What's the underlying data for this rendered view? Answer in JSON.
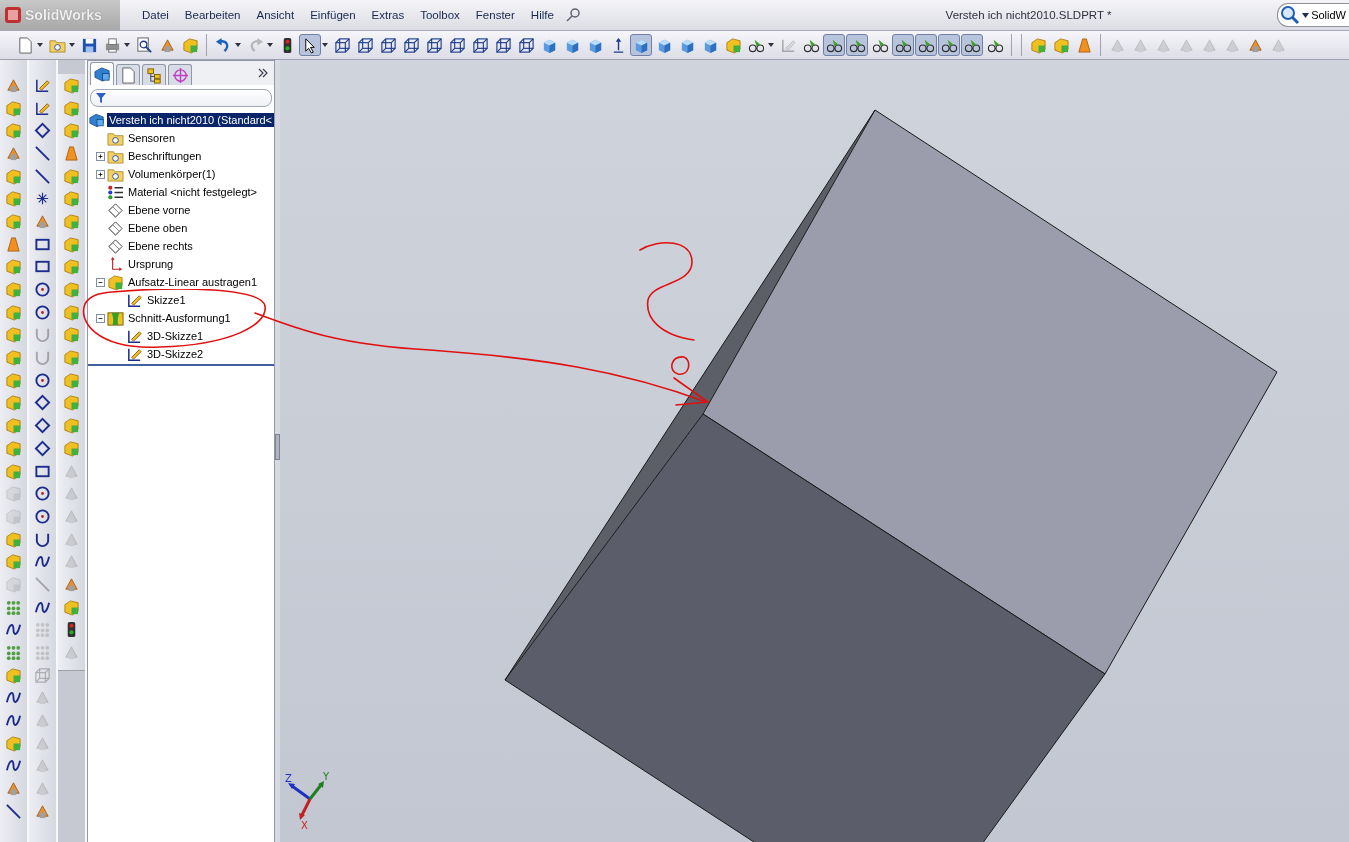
{
  "app": {
    "logo": "SolidWorks"
  },
  "menu": [
    "Datei",
    "Bearbeiten",
    "Ansicht",
    "Einfügen",
    "Extras",
    "Toolbox",
    "Fenster",
    "Hilfe"
  ],
  "window": {
    "title": "Versteh ich nicht2010.SLDPRT *"
  },
  "search": {
    "value": "SolidW"
  },
  "toolbar": [
    {
      "kind": "page",
      "caret": true,
      "selected": false,
      "disabled": false
    },
    {
      "kind": "folder",
      "caret": true,
      "selected": false,
      "disabled": false
    },
    {
      "kind": "floppy",
      "caret": false,
      "selected": false,
      "disabled": false
    },
    {
      "kind": "printer",
      "caret": true,
      "selected": false,
      "disabled": false
    },
    {
      "kind": "magnifier",
      "caret": false,
      "selected": false,
      "disabled": false
    },
    {
      "kind": "tool",
      "caret": false,
      "selected": false,
      "disabled": false
    },
    {
      "kind": "box",
      "caret": false,
      "selected": false,
      "disabled": false
    },
    {
      "kind": "separator"
    },
    {
      "kind": "undo",
      "caret": true,
      "selected": false,
      "disabled": false
    },
    {
      "kind": "redo",
      "caret": true,
      "selected": false,
      "disabled": true
    },
    {
      "kind": "traffic-light",
      "caret": false,
      "selected": false,
      "disabled": false
    },
    {
      "kind": "cursor",
      "caret": true,
      "selected": true,
      "disabled": false
    },
    {
      "kind": "wire-cube",
      "caret": false,
      "selected": false,
      "disabled": false
    },
    {
      "kind": "wire-cube",
      "caret": false,
      "selected": false,
      "disabled": false
    },
    {
      "kind": "wire-cube",
      "caret": false,
      "selected": false,
      "disabled": false
    },
    {
      "kind": "wire-cube",
      "caret": false,
      "selected": false,
      "disabled": false
    },
    {
      "kind": "wire-cube",
      "caret": false,
      "selected": false,
      "disabled": false
    },
    {
      "kind": "wire-cube",
      "caret": false,
      "selected": false,
      "disabled": false
    },
    {
      "kind": "wire-cube",
      "caret": false,
      "selected": false,
      "disabled": false
    },
    {
      "kind": "wire-cube",
      "caret": false,
      "selected": false,
      "disabled": false
    },
    {
      "kind": "wire-cube",
      "caret": false,
      "selected": false,
      "disabled": false
    },
    {
      "kind": "cube",
      "caret": false,
      "selected": false,
      "disabled": false
    },
    {
      "kind": "cube",
      "caret": false,
      "selected": false,
      "disabled": false
    },
    {
      "kind": "cube",
      "caret": false,
      "selected": false,
      "disabled": false
    },
    {
      "kind": "arrow",
      "caret": false,
      "selected": false,
      "disabled": false
    },
    {
      "kind": "cube",
      "caret": false,
      "selected": true,
      "disabled": false
    },
    {
      "kind": "cube",
      "caret": false,
      "selected": false,
      "disabled": false
    },
    {
      "kind": "cube",
      "caret": false,
      "selected": false,
      "disabled": false
    },
    {
      "kind": "cube",
      "caret": false,
      "selected": false,
      "disabled": false
    },
    {
      "kind": "box",
      "caret": false,
      "selected": false,
      "disabled": false
    },
    {
      "kind": "glasses",
      "caret": true,
      "selected": false,
      "disabled": false
    },
    {
      "kind": "pencil",
      "caret": false,
      "selected": false,
      "disabled": true
    },
    {
      "kind": "glasses",
      "caret": false,
      "selected": false,
      "disabled": false
    },
    {
      "kind": "glasses",
      "caret": false,
      "selected": true,
      "disabled": false
    },
    {
      "kind": "glasses",
      "caret": false,
      "selected": true,
      "disabled": false
    },
    {
      "kind": "glasses",
      "caret": false,
      "selected": false,
      "disabled": false
    },
    {
      "kind": "glasses",
      "caret": false,
      "selected": true,
      "disabled": false
    },
    {
      "kind": "glasses",
      "caret": false,
      "selected": true,
      "disabled": false
    },
    {
      "kind": "glasses",
      "caret": false,
      "selected": true,
      "disabled": false
    },
    {
      "kind": "glasses",
      "caret": false,
      "selected": true,
      "disabled": false
    },
    {
      "kind": "glasses",
      "caret": false,
      "selected": false,
      "disabled": false
    },
    {
      "kind": "separator"
    },
    {
      "kind": "separator"
    },
    {
      "kind": "box",
      "caret": false,
      "selected": false,
      "disabled": false
    },
    {
      "kind": "box",
      "caret": false,
      "selected": false,
      "disabled": false
    },
    {
      "kind": "cone",
      "caret": false,
      "selected": false,
      "disabled": false
    },
    {
      "kind": "separator"
    },
    {
      "kind": "tool",
      "caret": false,
      "selected": false,
      "disabled": true
    },
    {
      "kind": "tool",
      "caret": false,
      "selected": false,
      "disabled": true
    },
    {
      "kind": "tool",
      "caret": false,
      "selected": false,
      "disabled": true
    },
    {
      "kind": "tool",
      "caret": false,
      "selected": false,
      "disabled": true
    },
    {
      "kind": "tool",
      "caret": false,
      "selected": false,
      "disabled": true
    },
    {
      "kind": "tool",
      "caret": false,
      "selected": false,
      "disabled": true
    },
    {
      "kind": "tool",
      "caret": false,
      "selected": false,
      "disabled": false
    },
    {
      "kind": "tool",
      "caret": false,
      "selected": false,
      "disabled": true
    }
  ],
  "side_toolbars": [
    {
      "buttons": [
        {
          "kind": "tool",
          "disabled": false
        },
        {
          "kind": "box",
          "disabled": false
        },
        {
          "kind": "box",
          "disabled": false
        },
        {
          "kind": "tool",
          "disabled": false
        },
        {
          "kind": "box",
          "disabled": false
        },
        {
          "kind": "box",
          "disabled": false
        },
        {
          "kind": "box",
          "disabled": false
        },
        {
          "kind": "cone",
          "disabled": false
        },
        {
          "kind": "box",
          "disabled": false
        },
        {
          "kind": "box",
          "disabled": false
        },
        {
          "kind": "box",
          "disabled": false
        },
        {
          "kind": "box",
          "disabled": false
        },
        {
          "kind": "box",
          "disabled": false
        },
        {
          "kind": "box",
          "disabled": false
        },
        {
          "kind": "box",
          "disabled": false
        },
        {
          "kind": "box",
          "disabled": false
        },
        {
          "kind": "box",
          "disabled": false
        },
        {
          "kind": "box",
          "disabled": false
        },
        {
          "kind": "box",
          "disabled": true
        },
        {
          "kind": "box",
          "disabled": true
        },
        {
          "kind": "box",
          "disabled": false
        },
        {
          "kind": "box",
          "disabled": false
        },
        {
          "kind": "box",
          "disabled": true
        },
        {
          "kind": "grid",
          "disabled": false
        },
        {
          "kind": "spline",
          "disabled": false
        },
        {
          "kind": "grid",
          "disabled": false
        },
        {
          "kind": "box",
          "disabled": false
        },
        {
          "kind": "spline",
          "disabled": false
        },
        {
          "kind": "spline",
          "disabled": false
        },
        {
          "kind": "box",
          "disabled": false
        },
        {
          "kind": "spline",
          "disabled": false
        },
        {
          "kind": "tool",
          "disabled": false
        },
        {
          "kind": "line",
          "disabled": false
        }
      ]
    },
    {
      "buttons": [
        {
          "kind": "pencil",
          "disabled": false
        },
        {
          "kind": "pencil",
          "disabled": false
        },
        {
          "kind": "diamond",
          "disabled": false
        },
        {
          "kind": "line",
          "disabled": false
        },
        {
          "kind": "line",
          "disabled": false
        },
        {
          "kind": "point",
          "disabled": false
        },
        {
          "kind": "tool",
          "disabled": false
        },
        {
          "kind": "rect",
          "disabled": false
        },
        {
          "kind": "rect",
          "disabled": false
        },
        {
          "kind": "circle",
          "disabled": false
        },
        {
          "kind": "circle",
          "disabled": false
        },
        {
          "kind": "arc",
          "disabled": true
        },
        {
          "kind": "arc",
          "disabled": true
        },
        {
          "kind": "circle",
          "disabled": false
        },
        {
          "kind": "diamond",
          "disabled": false
        },
        {
          "kind": "diamond",
          "disabled": false
        },
        {
          "kind": "diamond",
          "disabled": false
        },
        {
          "kind": "rect",
          "disabled": false
        },
        {
          "kind": "circle",
          "disabled": false
        },
        {
          "kind": "circle",
          "disabled": false
        },
        {
          "kind": "arc",
          "disabled": false
        },
        {
          "kind": "spline",
          "disabled": false
        },
        {
          "kind": "line",
          "disabled": true
        },
        {
          "kind": "spline",
          "disabled": false
        },
        {
          "kind": "grid",
          "disabled": true
        },
        {
          "kind": "grid",
          "disabled": true
        },
        {
          "kind": "wire-cube",
          "disabled": true
        },
        {
          "kind": "tool",
          "disabled": true
        },
        {
          "kind": "tool",
          "disabled": true
        },
        {
          "kind": "tool",
          "disabled": true
        },
        {
          "kind": "tool",
          "disabled": true
        },
        {
          "kind": "tool",
          "disabled": true
        },
        {
          "kind": "tool",
          "disabled": false
        }
      ]
    },
    {
      "buttons": [
        {
          "kind": "box",
          "disabled": false
        },
        {
          "kind": "box",
          "disabled": false
        },
        {
          "kind": "box",
          "disabled": false
        },
        {
          "kind": "cone",
          "disabled": false
        },
        {
          "kind": "box",
          "disabled": false
        },
        {
          "kind": "box",
          "disabled": false
        },
        {
          "kind": "box",
          "disabled": false
        },
        {
          "kind": "box",
          "disabled": false
        },
        {
          "kind": "box",
          "disabled": false
        },
        {
          "kind": "box",
          "disabled": false
        },
        {
          "kind": "box",
          "disabled": false
        },
        {
          "kind": "box",
          "disabled": false
        },
        {
          "kind": "box",
          "disabled": false
        },
        {
          "kind": "box",
          "disabled": false
        },
        {
          "kind": "box",
          "disabled": false
        },
        {
          "kind": "box",
          "disabled": false
        },
        {
          "kind": "box",
          "disabled": false
        },
        {
          "kind": "tool",
          "disabled": true
        },
        {
          "kind": "tool",
          "disabled": true
        },
        {
          "kind": "tool",
          "disabled": true
        },
        {
          "kind": "tool",
          "disabled": true
        },
        {
          "kind": "tool",
          "disabled": true
        },
        {
          "kind": "tool",
          "disabled": false
        },
        {
          "kind": "box",
          "disabled": false
        },
        {
          "kind": "traffic-light",
          "disabled": false
        },
        {
          "kind": "tool",
          "disabled": true
        }
      ]
    }
  ],
  "panel": {
    "tabs": [
      {
        "kind": "part",
        "selected": true
      },
      {
        "kind": "page",
        "selected": false
      },
      {
        "kind": "tree",
        "selected": false
      },
      {
        "kind": "target",
        "selected": false
      }
    ],
    "tree": [
      {
        "kind": "part",
        "label": "Versteh ich nicht2010  (Standard<",
        "selected": true,
        "children": [
          {
            "kind": "folder",
            "label": "Sensoren",
            "selected": false
          },
          {
            "kind": "folder",
            "label": "Beschriftungen",
            "selected": false,
            "expanded": false
          },
          {
            "kind": "folder",
            "label": "Volumenkörper(1)",
            "selected": false,
            "expanded": false
          },
          {
            "kind": "material",
            "label": "Material <nicht festgelegt>",
            "selected": false
          },
          {
            "kind": "plane",
            "label": "Ebene vorne",
            "selected": false
          },
          {
            "kind": "plane",
            "label": "Ebene oben",
            "selected": false
          },
          {
            "kind": "plane",
            "label": "Ebene rechts",
            "selected": false
          },
          {
            "kind": "origin",
            "label": "Ursprung",
            "selected": false
          },
          {
            "kind": "box",
            "label": "Aufsatz-Linear austragen1",
            "selected": false,
            "expanded": true,
            "children": [
              {
                "kind": "pencil",
                "label": "Skizze1",
                "selected": false
              }
            ]
          },
          {
            "kind": "loft",
            "label": "Schnitt-Ausformung1",
            "selected": false,
            "expanded": true,
            "children": [
              {
                "kind": "pencil",
                "label": "3D-Skizze1",
                "selected": false
              },
              {
                "kind": "pencil",
                "label": "3D-Skizze2",
                "selected": false
              }
            ]
          }
        ]
      }
    ]
  },
  "triad": {
    "x": "X",
    "y": "Y",
    "z": "Z"
  }
}
